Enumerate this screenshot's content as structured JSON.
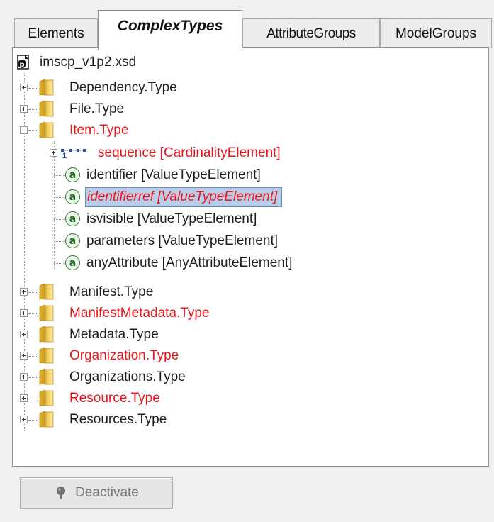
{
  "tabs": [
    {
      "label": "Elements"
    },
    {
      "label": "ComplexTypes"
    },
    {
      "label": "AttributeGroups"
    },
    {
      "label": "ModelGroups"
    }
  ],
  "tree": {
    "root": "imscp_v1p2.xsd",
    "types": {
      "dependency": "Dependency.Type",
      "file": "File.Type",
      "item": "Item.Type",
      "manifest": "Manifest.Type",
      "manifest_metadata": "ManifestMetadata.Type",
      "metadata": "Metadata.Type",
      "organization": "Organization.Type",
      "organizations": "Organizations.Type",
      "resource": "Resource.Type",
      "resources": "Resources.Type"
    },
    "item_children": {
      "sequence": "sequence [CardinalityElement]",
      "sequence_cardinality": "1",
      "identifier": "identifier [ValueTypeElement]",
      "identifierref": "identifierref [ValueTypeElement]",
      "isvisible": "isvisible [ValueTypeElement]",
      "parameters": "parameters [ValueTypeElement]",
      "anyattribute": "anyAttribute [AnyAttributeElement]"
    },
    "attr_glyph": "a"
  },
  "footer": {
    "deactivate_label": "Deactivate"
  },
  "colors": {
    "modified_text": "#e8141a",
    "normal_text": "#1e1e1e",
    "selection_bg": "#b7cde8",
    "attr_icon": "#2c7a2c"
  }
}
